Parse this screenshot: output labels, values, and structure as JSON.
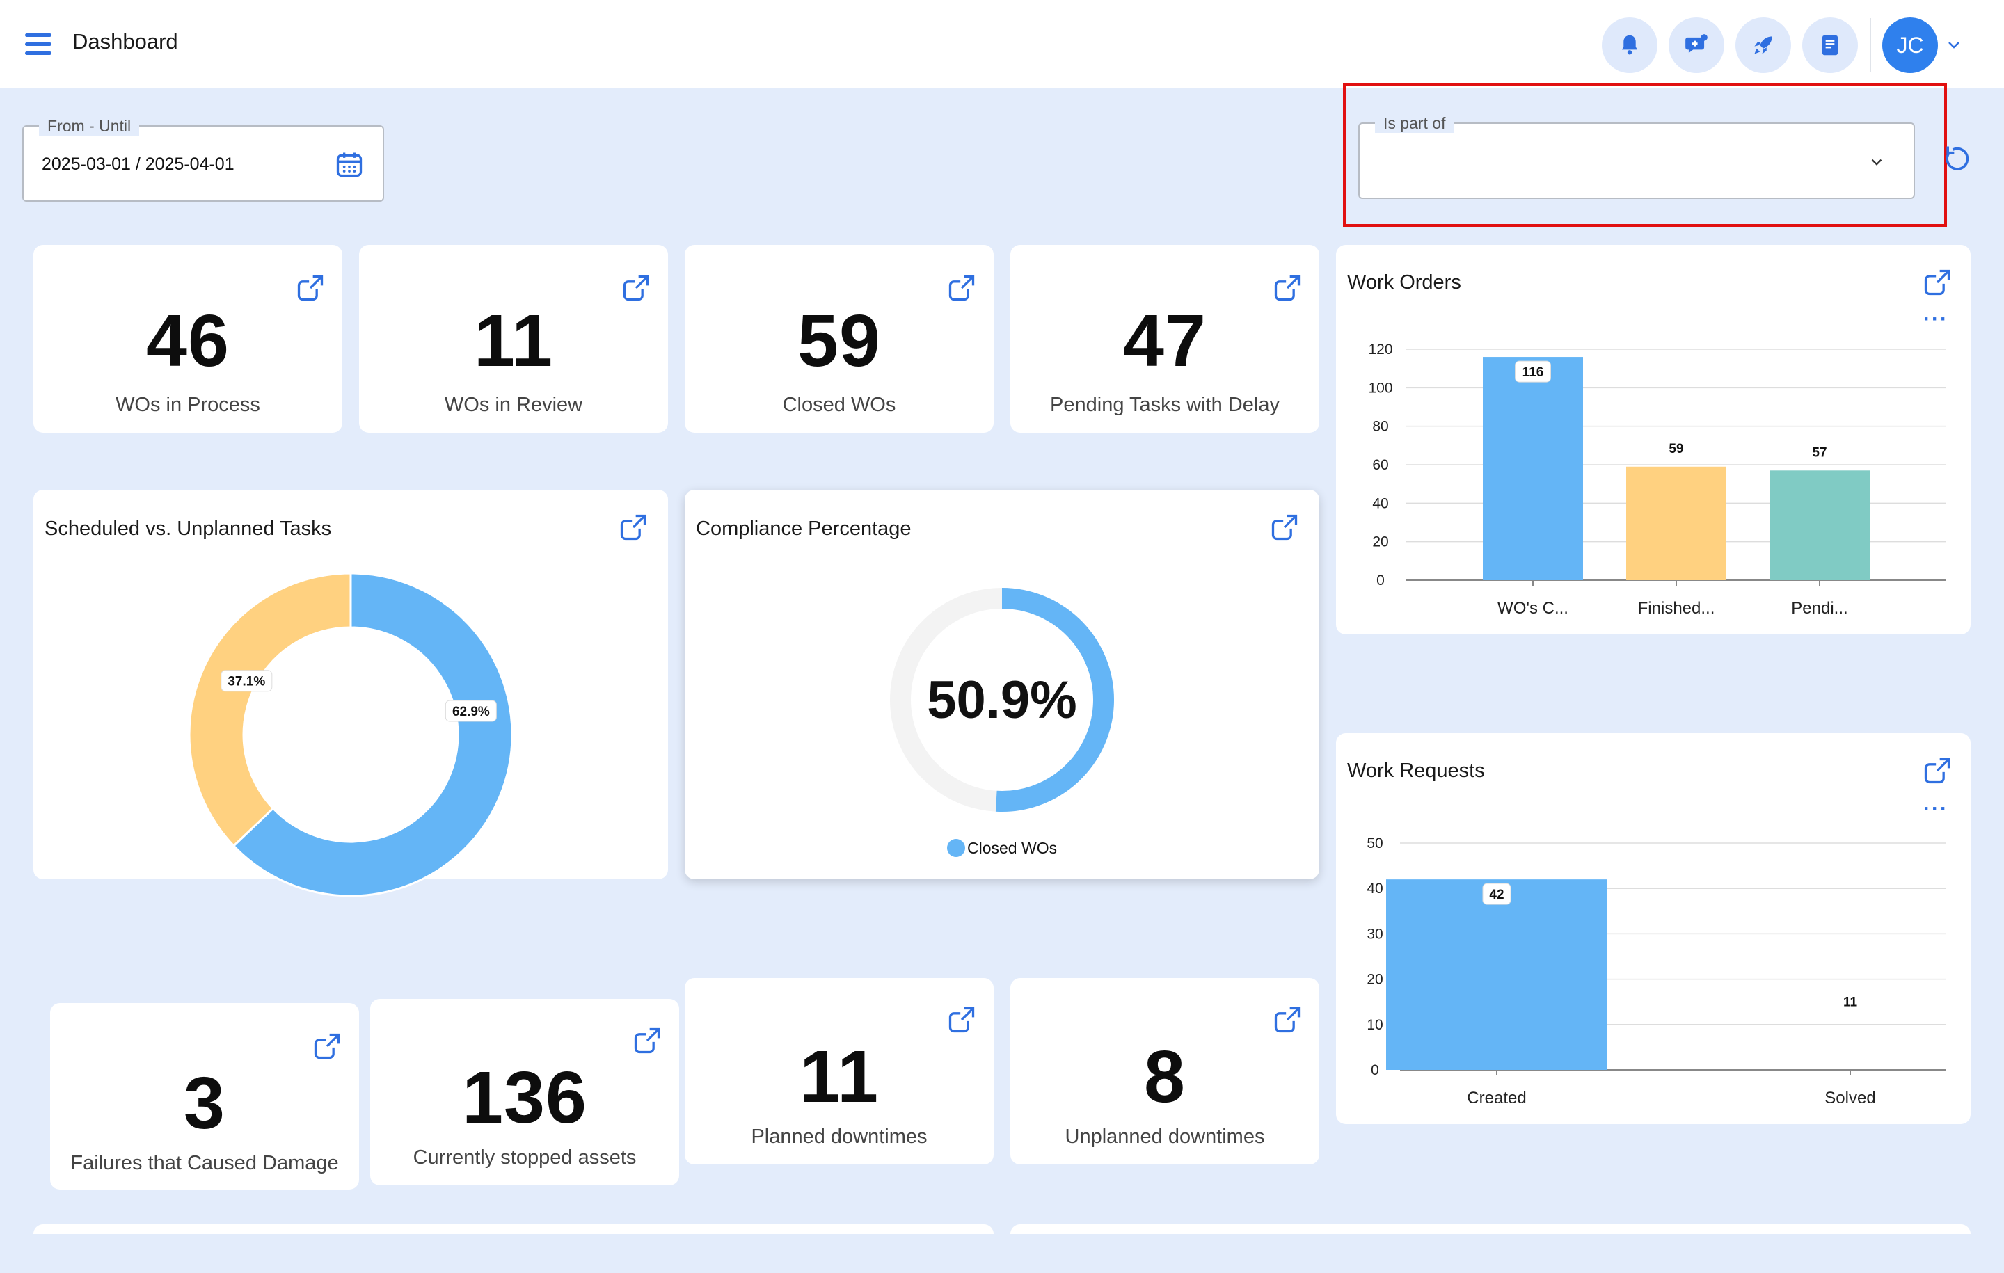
{
  "header": {
    "title": "Dashboard",
    "avatar_initials": "JC",
    "icons": [
      "bell-icon",
      "chat-plus-icon",
      "rocket-icon",
      "book-icon"
    ]
  },
  "filters": {
    "date_range": {
      "label": "From - Until",
      "value": "2025-03-01 / 2025-04-01"
    },
    "is_part_of": {
      "label": "Is part of",
      "value": ""
    }
  },
  "kpis": {
    "wos_in_process": {
      "value": "46",
      "label": "WOs in Process"
    },
    "wos_in_review": {
      "value": "11",
      "label": "WOs in Review"
    },
    "closed_wos": {
      "value": "59",
      "label": "Closed WOs"
    },
    "pending_tasks_delay": {
      "value": "47",
      "label": "Pending Tasks with Delay"
    },
    "failures_damage": {
      "value": "3",
      "label": "Failures that Caused Damage"
    },
    "stopped_assets": {
      "value": "136",
      "label": "Currently stopped assets"
    },
    "planned_downtimes": {
      "value": "11",
      "label": "Planned downtimes"
    },
    "unplanned_downtimes": {
      "value": "8",
      "label": "Unplanned downtimes"
    }
  },
  "cards": {
    "scheduled_vs_unplanned": {
      "title": "Scheduled vs. Unplanned Tasks"
    },
    "compliance": {
      "title": "Compliance Percentage"
    },
    "work_orders": {
      "title": "Work Orders"
    },
    "work_requests": {
      "title": "Work Requests"
    }
  },
  "colors": {
    "blue": "#64b5f6",
    "orange": "#ffd180",
    "teal": "#80cbc4",
    "accent": "#2f6fe0"
  },
  "chart_data": [
    {
      "type": "pie",
      "title": "Scheduled vs. Unplanned Tasks",
      "slices": [
        {
          "label": "62.9%",
          "value": 62.9,
          "color": "#64b5f6"
        },
        {
          "label": "37.1%",
          "value": 37.1,
          "color": "#ffd180"
        }
      ]
    },
    {
      "type": "pie",
      "title": "Compliance Percentage",
      "center_label": "50.9%",
      "value": 50.9,
      "legend": [
        "Closed WOs"
      ],
      "color": "#64b5f6",
      "track_color": "#f3f3f3"
    },
    {
      "type": "bar",
      "title": "Work Orders",
      "categories": [
        "WO's C...",
        "Finished...",
        "Pendi..."
      ],
      "values": [
        116,
        59,
        57
      ],
      "colors": [
        "#64b5f6",
        "#ffd180",
        "#80cbc4"
      ],
      "ylim": [
        0,
        120
      ],
      "yticks": [
        "0",
        "20",
        "40",
        "60",
        "80",
        "100",
        "120"
      ]
    },
    {
      "type": "bar",
      "title": "Work Requests",
      "categories": [
        "Created",
        "Solved"
      ],
      "values": [
        42,
        11
      ],
      "colors": [
        "#64b5f6",
        "#64b5f6"
      ],
      "ylim": [
        0,
        50
      ],
      "yticks": [
        "0",
        "10",
        "20",
        "30",
        "40",
        "50"
      ]
    }
  ]
}
